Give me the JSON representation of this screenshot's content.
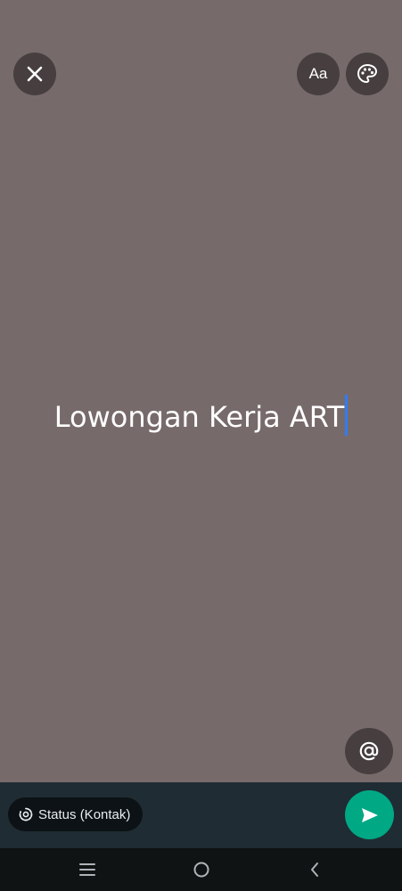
{
  "colors": {
    "canvas_background": "#776a6b",
    "bottom_bar_background": "#1f2c33",
    "nav_bar_background": "#0f1314",
    "send_button": "#00a884",
    "caret": "#2f7cf6",
    "nav_icon": "#aeb4b7"
  },
  "editor": {
    "text": "Lowongan Kerja ART"
  },
  "toolbar": {
    "close_icon": "close-icon",
    "font_label": "Aa",
    "palette_icon": "palette-icon"
  },
  "mention": {
    "icon": "at-icon"
  },
  "bottom_bar": {
    "audience_label": "Status (Kontak)",
    "audience_icon": "status-icon",
    "send_icon": "send-icon"
  },
  "navigation": {
    "recents_icon": "recents-icon",
    "home_icon": "home-icon",
    "back_icon": "back-icon"
  }
}
